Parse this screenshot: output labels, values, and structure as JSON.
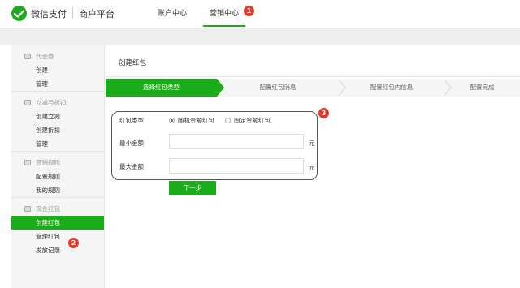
{
  "header": {
    "brand": "微信支付",
    "sub_brand": "商户平台",
    "nav": [
      {
        "label": "账户中心"
      },
      {
        "label": "营销中心",
        "badge": "1"
      }
    ]
  },
  "sidebar": {
    "groups": [
      {
        "title": "代金券",
        "items": [
          "创建",
          "管理"
        ]
      },
      {
        "title": "立减与折扣",
        "items": [
          "创建立减",
          "创建折扣",
          "管理"
        ]
      },
      {
        "title": "营销规则",
        "items": [
          "配置规则",
          "我的规则"
        ]
      },
      {
        "title": "现金红包",
        "items": [
          "创建红包",
          "管理红包",
          "发放记录"
        ]
      }
    ],
    "active_badge": "2"
  },
  "main": {
    "title": "创建红包",
    "steps": [
      "选择红包类型",
      "配置红包消息",
      "配置红包内信息",
      "配置完成"
    ],
    "form": {
      "type_label": "红包类型",
      "options": [
        "随机金额红包",
        "固定金额红包"
      ],
      "selected_option": "随机金额红包",
      "min_label": "最小金额",
      "min_value": "",
      "max_label": "最大金额",
      "max_value": "",
      "unit": "元",
      "badge": "3"
    },
    "next_button": "下一步"
  },
  "colors": {
    "brand_green": "#1aad19",
    "badge_red": "#e33a2b"
  }
}
